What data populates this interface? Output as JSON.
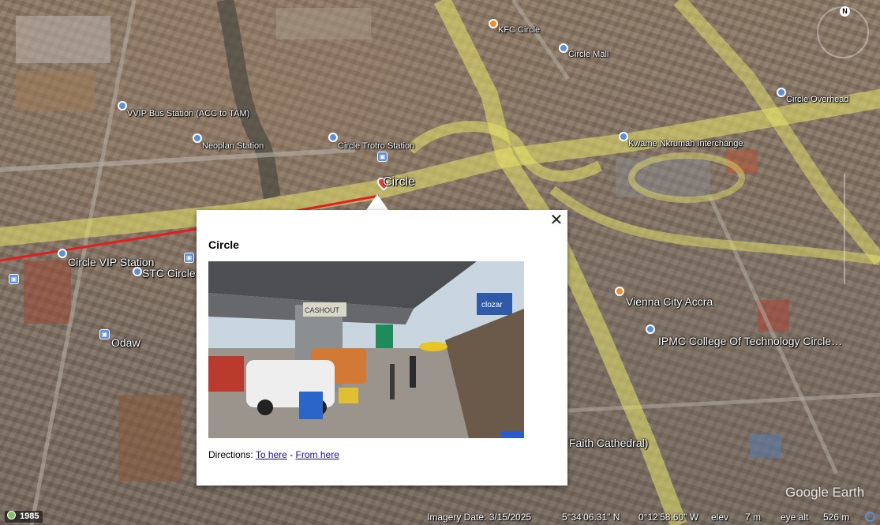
{
  "map": {
    "labels": {
      "kfc": "KFC Circle",
      "circle_mall": "Circle Mall",
      "circle_overhead": "Circle Overhead",
      "vvip": "VVIP Bus Station (ACC to TAM)",
      "neoplan": "Neoplan Station",
      "trotro": "Circle Trotro Station",
      "kwame": "Kwame Nkrumah Interchange",
      "circle": "Circle",
      "circle_vip": "Circle VIP Station",
      "stc": "STC Circle",
      "odaw": "Odaw",
      "vienna": "Vienna City Accra",
      "ipmc": "IPMC College Of Technology Circle…",
      "faith": "Faith Cathedral)"
    },
    "compass_letter": "N",
    "logo": "Google Earth"
  },
  "popup": {
    "title": "Circle",
    "directions_label": "Directions:",
    "to_here": "To here",
    "separator": " - ",
    "from_here": "From here",
    "close_symbol": "✕",
    "photo_signs": {
      "cashout": "CASHOUT",
      "clozar": "clozar"
    }
  },
  "statusbar": {
    "year": "1985",
    "imagery_date": "Imagery Date: 3/15/2025",
    "lat": "5°34'06.31\" N",
    "lon": "0°12'58.60\" W",
    "elev_label": "elev",
    "elev_value": "7 m",
    "eye_label": "eye alt",
    "eye_value": "526 m"
  },
  "colors": {
    "road_highlight": "#e8e46a",
    "route_line": "#e02020",
    "link": "#1a0dab"
  }
}
